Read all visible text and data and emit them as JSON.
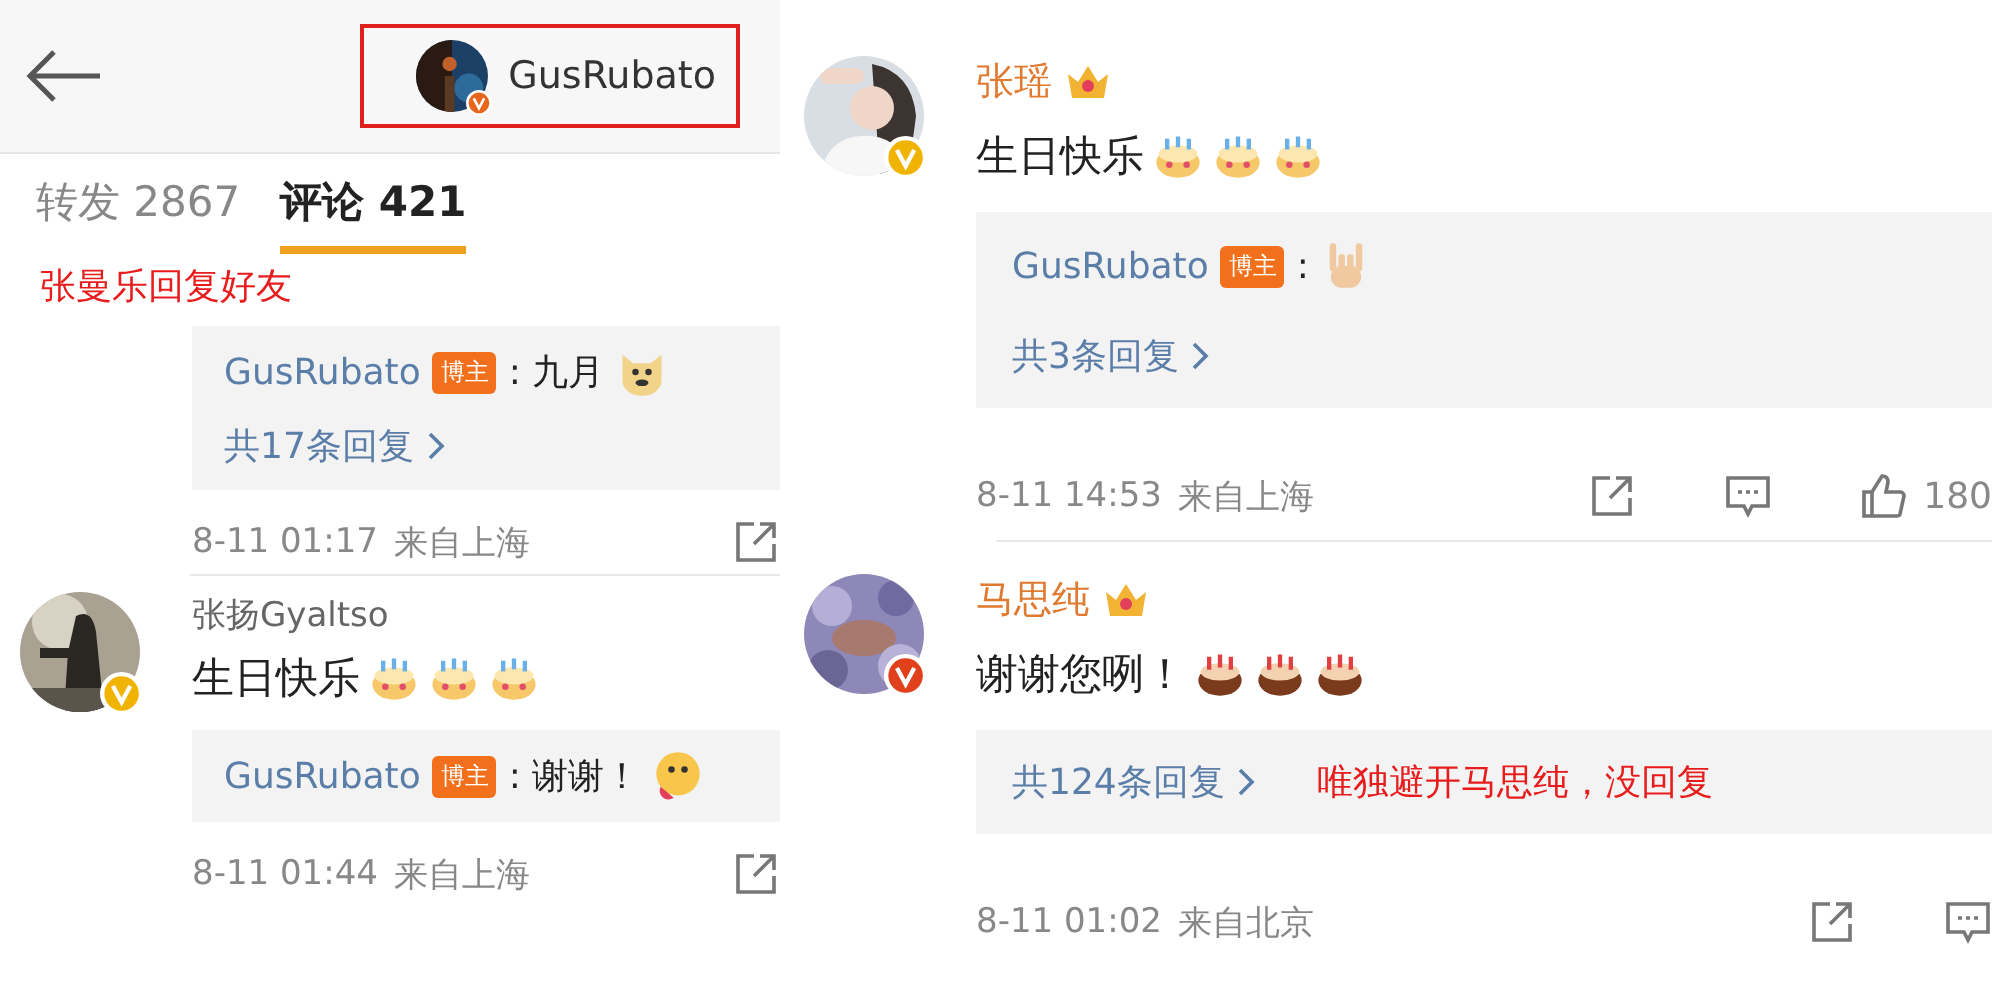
{
  "left": {
    "header": {
      "username": "GusRubato",
      "highlighted": true,
      "avatar": {
        "color": "#e8661c"
      }
    },
    "tabs": [
      {
        "label": "转发 2867",
        "selected": false
      },
      {
        "label": "评论 421",
        "selected": true
      }
    ],
    "annotation": "张曼乐回复好友",
    "comments": [
      {
        "reply": {
          "author": "GusRubato",
          "badge": "博主",
          "text": ": 九月",
          "emoji": {
            "kind": "dog"
          }
        },
        "more_replies": "共17条回复",
        "time": "8-11 01:17",
        "location": "来自上海",
        "actions": [
          {
            "kind": "share"
          }
        ]
      },
      {
        "avatar": {
          "color": "#f0b400"
        },
        "author": "张扬Gyaltso",
        "vip": false,
        "text": "生日快乐",
        "emojis": [
          {
            "kind": "cake"
          },
          {
            "kind": "cake"
          },
          {
            "kind": "cake"
          }
        ],
        "reply": {
          "author": "GusRubato",
          "badge": "博主",
          "text": ": 谢谢！",
          "emoji": {
            "kind": "tongue"
          }
        },
        "time": "8-11 01:44",
        "location": "来自上海",
        "actions": [
          {
            "kind": "share"
          }
        ]
      }
    ]
  },
  "right": {
    "comments": [
      {
        "avatar": {
          "color": "#f0b400"
        },
        "author": "张瑶",
        "vip": true,
        "text": "生日快乐",
        "emojis": [
          {
            "kind": "cake"
          },
          {
            "kind": "cake"
          },
          {
            "kind": "cake"
          }
        ],
        "reply": {
          "author": "GusRubato",
          "badge": "博主",
          "text": ":",
          "emoji": {
            "kind": "hand"
          }
        },
        "more_replies": "共3条回复",
        "time": "8-11 14:53",
        "location": "来自上海",
        "actions": [
          {
            "kind": "share"
          },
          {
            "kind": "comment"
          },
          {
            "kind": "like",
            "count": "180"
          }
        ]
      },
      {
        "avatar": {
          "color": "#e0401c"
        },
        "author": "马思纯",
        "vip": true,
        "text": "谢谢您咧！",
        "emojis": [
          {
            "kind": "chocolate"
          },
          {
            "kind": "chocolate"
          },
          {
            "kind": "chocolate"
          }
        ],
        "more_replies": "共124条回复",
        "annotation": "唯独避开马思纯，没回复",
        "time": "8-11 01:02",
        "location": "来自北京",
        "actions": [
          {
            "kind": "share"
          },
          {
            "kind": "comment"
          }
        ]
      }
    ]
  }
}
